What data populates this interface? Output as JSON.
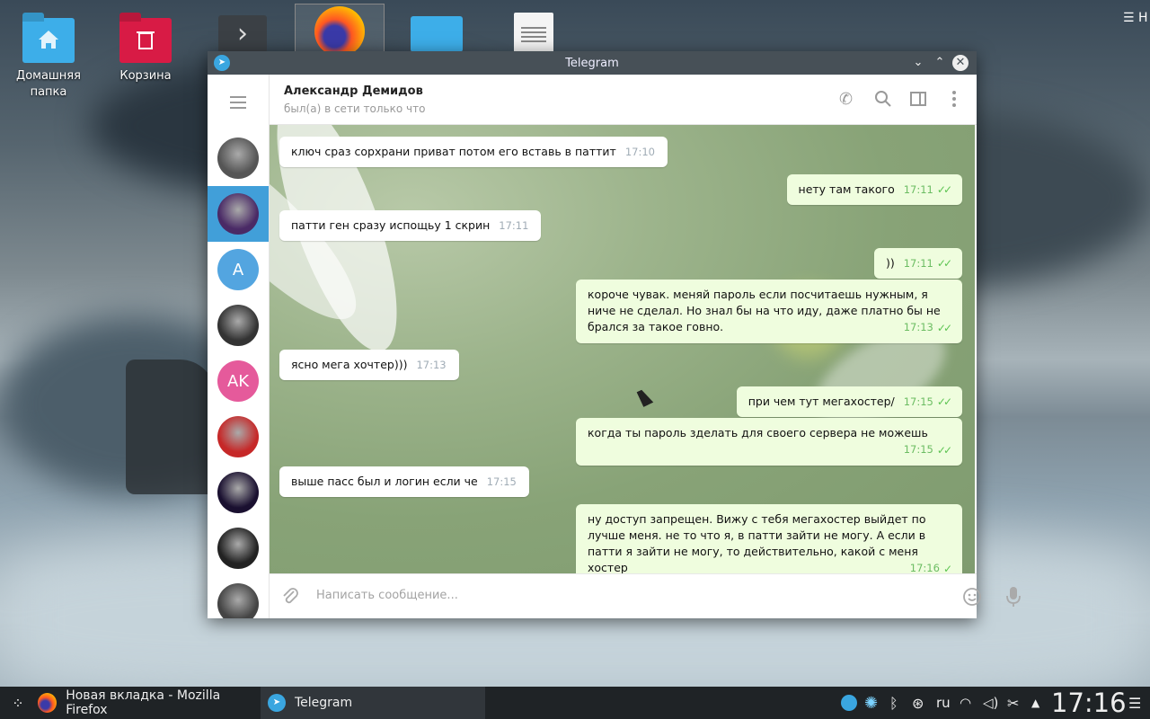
{
  "desktop": {
    "icons": [
      {
        "label": "Домашняя папка",
        "icon": "home-folder-icon"
      },
      {
        "label": "Корзина",
        "icon": "trash-folder-icon"
      }
    ],
    "corner_label": "Н"
  },
  "window": {
    "title": "Telegram",
    "chat_header": {
      "name": "Александр Демидов",
      "status": "был(а) в сети только что"
    },
    "sidebar_avatars": [
      {
        "initials": "",
        "color": "#555"
      },
      {
        "initials": "",
        "color": "#4a2a66"
      },
      {
        "initials": "A",
        "color": "#53a5e0"
      },
      {
        "initials": "",
        "color": "#333"
      },
      {
        "initials": "AK",
        "color": "#e55a9b"
      },
      {
        "initials": "",
        "color": "#c62828"
      },
      {
        "initials": "",
        "color": "#1a1030"
      },
      {
        "initials": "",
        "color": "#222"
      },
      {
        "initials": "",
        "color": "#444"
      }
    ],
    "messages": [
      {
        "dir": "in",
        "text": "ключ сраз сорхрани приват потом его вставь в паттит",
        "time": "17:10"
      },
      {
        "dir": "out",
        "text": "нету там такого",
        "time": "17:11",
        "read": true
      },
      {
        "dir": "in",
        "text": "патти ген сразу испощьу 1 скрин",
        "time": "17:11"
      },
      {
        "dir": "out",
        "text": "))",
        "time": "17:11",
        "read": true
      },
      {
        "dir": "out",
        "text": "короче чувак. меняй пароль если посчитаешь нужным, я ниче не сделал. Но знал бы на что иду, даже платно бы не брался за такое говно.",
        "time": "17:13",
        "read": true
      },
      {
        "dir": "in",
        "text": "ясно мега хочтер)))",
        "time": "17:13"
      },
      {
        "dir": "out",
        "text": "при чем тут мегахостер/",
        "time": "17:15",
        "read": true
      },
      {
        "dir": "out",
        "text": "когда ты пароль зделать для своего сервера не можешь",
        "time": "17:15",
        "read": true
      },
      {
        "dir": "in",
        "text": "выше пасс был и логин если че",
        "time": "17:15"
      },
      {
        "dir": "out",
        "text": "ну доступ запрещен. Вижу с тебя мегахостер выйдет по лучше меня. не то что я, в патти зайти не могу. А если в патти я зайти не могу, то действительно, какой с меня хостер",
        "time": "17:16",
        "read": false
      }
    ],
    "compose_placeholder": "Написать сообщение..."
  },
  "taskbar": {
    "tasks": [
      {
        "label": "Новая вкладка - Mozilla Firefox",
        "icon": "firefox-icon"
      },
      {
        "label": "Telegram",
        "icon": "telegram-icon"
      }
    ],
    "keyboard_layout": "ru",
    "clock": "17:16"
  },
  "colors": {
    "accent": "#419fd9",
    "out_bubble": "#effdde",
    "read_ticks": "#5dc452",
    "titlebar": "#475057",
    "taskbar": "#1f2326"
  }
}
